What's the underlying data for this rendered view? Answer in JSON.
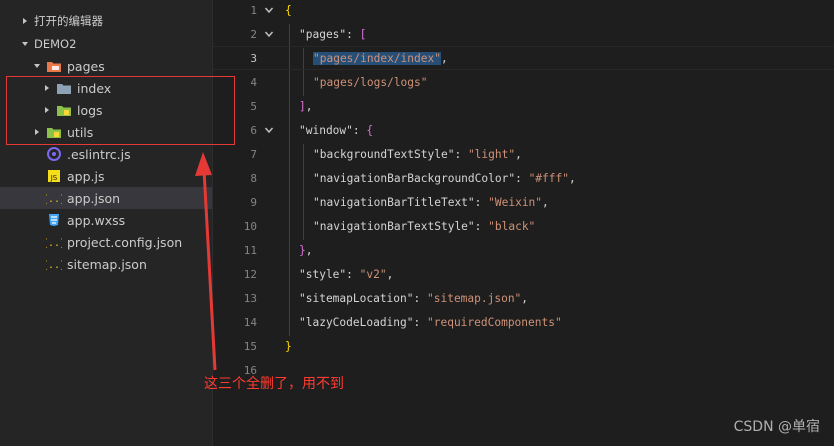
{
  "explorer": {
    "open_editors_label": "打开的编辑器",
    "project_label": "DEMO2",
    "tree": [
      {
        "label": "pages",
        "kind": "folder-open",
        "twisty": "down",
        "indent": 1
      },
      {
        "label": "index",
        "kind": "folder",
        "twisty": "right",
        "indent": 2
      },
      {
        "label": "logs",
        "kind": "folder-green",
        "twisty": "right",
        "indent": 2
      },
      {
        "label": "utils",
        "kind": "folder-green",
        "twisty": "right",
        "indent": 1
      },
      {
        "label": ".eslintrc.js",
        "kind": "eslint",
        "indent": 1
      },
      {
        "label": "app.js",
        "kind": "js",
        "indent": 1
      },
      {
        "label": "app.json",
        "kind": "json",
        "indent": 1,
        "selected": true
      },
      {
        "label": "app.wxss",
        "kind": "css",
        "indent": 1
      },
      {
        "label": "project.config.json",
        "kind": "json",
        "indent": 1
      },
      {
        "label": "sitemap.json",
        "kind": "json",
        "indent": 1
      }
    ]
  },
  "editor": {
    "active_line": 3,
    "lines": [
      {
        "n": "1",
        "fold": true,
        "tokens": [
          {
            "t": "{",
            "c": "brace"
          }
        ],
        "indent": 0
      },
      {
        "n": "2",
        "fold": true,
        "tokens": [
          {
            "t": "\"pages\"",
            "c": "key"
          },
          {
            "t": ": ",
            "c": "punc"
          },
          {
            "t": "[",
            "c": "brack"
          }
        ],
        "indent": 1
      },
      {
        "n": "3",
        "fold": false,
        "tokens": [
          {
            "t": "\"pages/index/index\"",
            "c": "str",
            "sel": true
          },
          {
            "t": ",",
            "c": "punc"
          }
        ],
        "indent": 2
      },
      {
        "n": "4",
        "fold": false,
        "tokens": [
          {
            "t": "\"pages/logs/logs\"",
            "c": "str"
          }
        ],
        "indent": 2
      },
      {
        "n": "5",
        "fold": false,
        "tokens": [
          {
            "t": "]",
            "c": "brack"
          },
          {
            "t": ",",
            "c": "punc"
          }
        ],
        "indent": 1
      },
      {
        "n": "6",
        "fold": true,
        "tokens": [
          {
            "t": "\"window\"",
            "c": "key"
          },
          {
            "t": ": ",
            "c": "punc"
          },
          {
            "t": "{",
            "c": "brace2"
          }
        ],
        "indent": 1
      },
      {
        "n": "7",
        "fold": false,
        "tokens": [
          {
            "t": "\"backgroundTextStyle\"",
            "c": "key"
          },
          {
            "t": ": ",
            "c": "punc"
          },
          {
            "t": "\"light\"",
            "c": "str"
          },
          {
            "t": ",",
            "c": "punc"
          }
        ],
        "indent": 2
      },
      {
        "n": "8",
        "fold": false,
        "tokens": [
          {
            "t": "\"navigationBarBackgroundColor\"",
            "c": "key"
          },
          {
            "t": ": ",
            "c": "punc"
          },
          {
            "t": "\"#fff\"",
            "c": "str"
          },
          {
            "t": ",",
            "c": "punc"
          }
        ],
        "indent": 2
      },
      {
        "n": "9",
        "fold": false,
        "tokens": [
          {
            "t": "\"navigationBarTitleText\"",
            "c": "key"
          },
          {
            "t": ": ",
            "c": "punc"
          },
          {
            "t": "\"Weixin\"",
            "c": "str"
          },
          {
            "t": ",",
            "c": "punc"
          }
        ],
        "indent": 2
      },
      {
        "n": "10",
        "fold": false,
        "tokens": [
          {
            "t": "\"navigationBarTextStyle\"",
            "c": "key"
          },
          {
            "t": ": ",
            "c": "punc"
          },
          {
            "t": "\"black\"",
            "c": "str"
          }
        ],
        "indent": 2
      },
      {
        "n": "11",
        "fold": false,
        "tokens": [
          {
            "t": "}",
            "c": "brace2"
          },
          {
            "t": ",",
            "c": "punc"
          }
        ],
        "indent": 1
      },
      {
        "n": "12",
        "fold": false,
        "tokens": [
          {
            "t": "\"style\"",
            "c": "key"
          },
          {
            "t": ": ",
            "c": "punc"
          },
          {
            "t": "\"v2\"",
            "c": "str"
          },
          {
            "t": ",",
            "c": "punc"
          }
        ],
        "indent": 1
      },
      {
        "n": "13",
        "fold": false,
        "tokens": [
          {
            "t": "\"sitemapLocation\"",
            "c": "key"
          },
          {
            "t": ": ",
            "c": "punc"
          },
          {
            "t": "\"sitemap.json\"",
            "c": "str"
          },
          {
            "t": ",",
            "c": "punc"
          }
        ],
        "indent": 1
      },
      {
        "n": "14",
        "fold": false,
        "tokens": [
          {
            "t": "\"lazyCodeLoading\"",
            "c": "key"
          },
          {
            "t": ": ",
            "c": "punc"
          },
          {
            "t": "\"requiredComponents\"",
            "c": "str"
          }
        ],
        "indent": 1
      },
      {
        "n": "15",
        "fold": false,
        "tokens": [
          {
            "t": "}",
            "c": "brace"
          }
        ],
        "indent": 0
      },
      {
        "n": "16",
        "fold": false,
        "tokens": [],
        "indent": 0
      }
    ]
  },
  "annotation": {
    "text": "这三个全删了，用不到",
    "color": "#e53935"
  },
  "watermark": "CSDN @单宿",
  "colors": {
    "sidebar_bg": "#252526",
    "editor_bg": "#1e1e1e",
    "selection_bg": "#37373d",
    "string": "#ce9178",
    "key": "#d4d4d4",
    "brace": "#ffd700",
    "bracket": "#da70d6"
  }
}
